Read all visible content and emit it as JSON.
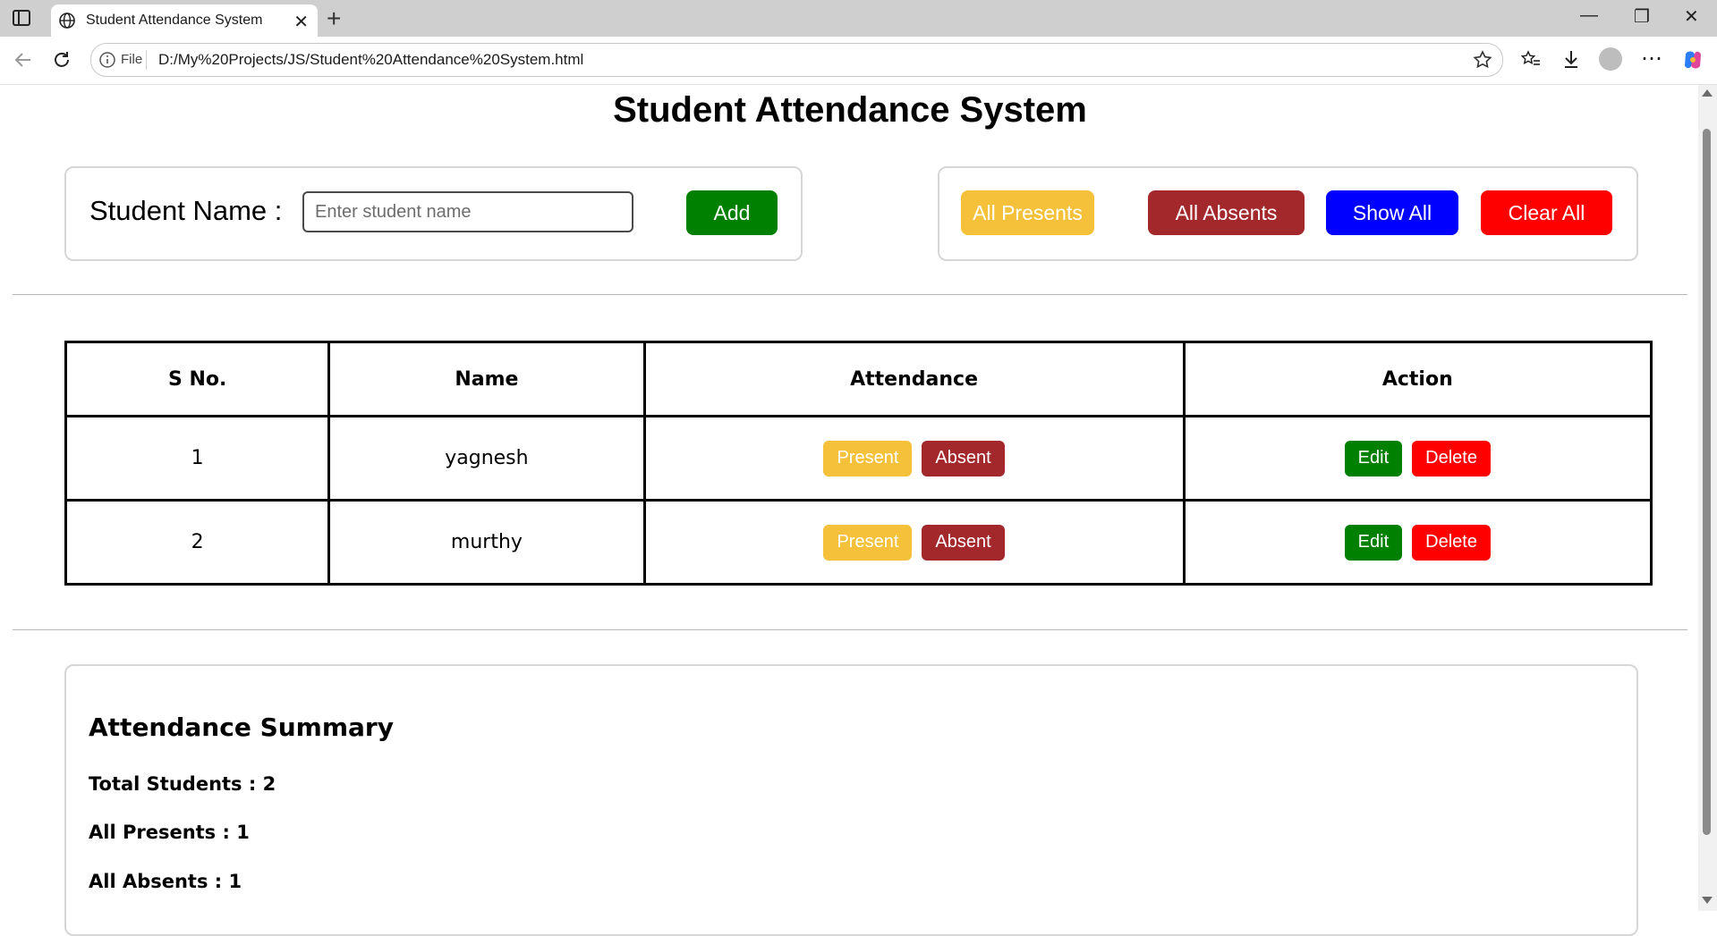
{
  "browser": {
    "tab_title": "Student Attendance System",
    "address_proto": "File",
    "url": "D:/My%20Projects/JS/Student%20Attendance%20System.html"
  },
  "page": {
    "title": "Student Attendance System",
    "form": {
      "label": "Student Name :",
      "input_placeholder": "Enter student name",
      "input_value": "",
      "add_label": "Add"
    },
    "bulk_actions": {
      "all_presents": "All Presents",
      "all_absents": "All Absents",
      "show_all": "Show All",
      "clear_all": "Clear All"
    },
    "table": {
      "headers": [
        "S No.",
        "Name",
        "Attendance",
        "Action"
      ],
      "rows": [
        {
          "sno": "1",
          "name": "yagnesh",
          "present": "Present",
          "absent": "Absent",
          "edit": "Edit",
          "delete": "Delete"
        },
        {
          "sno": "2",
          "name": "murthy",
          "present": "Present",
          "absent": "Absent",
          "edit": "Edit",
          "delete": "Delete"
        }
      ]
    },
    "summary": {
      "heading": "Attendance Summary",
      "total": "Total Students : 2",
      "presents": "All Presents : 1",
      "absents": "All Absents : 1"
    }
  },
  "colors": {
    "add": "#008000",
    "present": "#f5c13a",
    "absent": "#a3282b",
    "show_all": "#0000ff",
    "clear_all": "#ff0000"
  },
  "icons": [
    "sidebar-toggle-icon",
    "globe-icon",
    "close-icon",
    "plus-icon",
    "back-icon",
    "reload-icon",
    "info-icon",
    "star-icon",
    "favorites-icon",
    "download-icon",
    "profile-icon",
    "more-icon",
    "copilot-icon",
    "minimize-icon",
    "restore-icon",
    "window-close-icon"
  ]
}
